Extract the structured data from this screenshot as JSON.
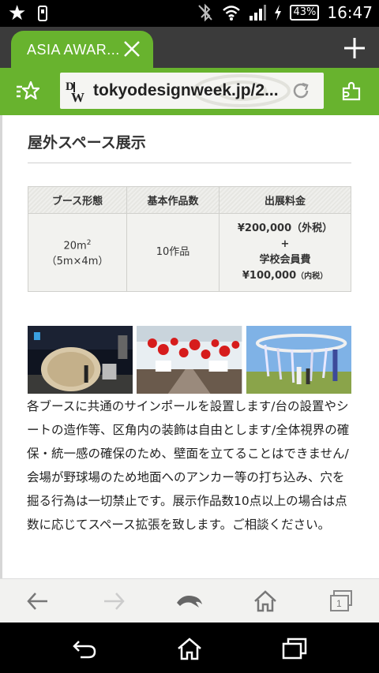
{
  "status_bar": {
    "battery": "43%",
    "time": "16:47"
  },
  "tab": {
    "title": "ASIA AWAR..."
  },
  "address_bar": {
    "logo": "DW",
    "url": "tokyodesignweek.jp/2..."
  },
  "content": {
    "section_title": "屋外スペース展示",
    "table": {
      "headers": [
        "ブース形態",
        "基本作品数",
        "出展料金"
      ],
      "booth_size": "20m",
      "booth_size_sup": "2",
      "booth_dims": "（5m×4m）",
      "works": "10作品",
      "fee_main": "¥200,000（外税）",
      "fee_plus": "+",
      "fee_member_label": "学校会員費",
      "fee_member_amount": "¥100,000",
      "fee_member_note": "（内税）"
    },
    "description": "各ブースに共通のサインポールを設置します/台の設置やシートの造作等、区角内の装飾は自由とします/全体視界の確保・統一感の確保のため、壁面を立てることはできません/会場が野球場のため地面へのアンカー等の打ち込み、穴を掘る行為は一切禁止です。展示作品数10点以上の場合は点数に応じてスペース拡張を致します。ご相談ください。"
  },
  "bottom_bar": {
    "tab_count": "1"
  },
  "colors": {
    "accent": "#68b32e",
    "tab_strip": "#3b3b3b"
  }
}
